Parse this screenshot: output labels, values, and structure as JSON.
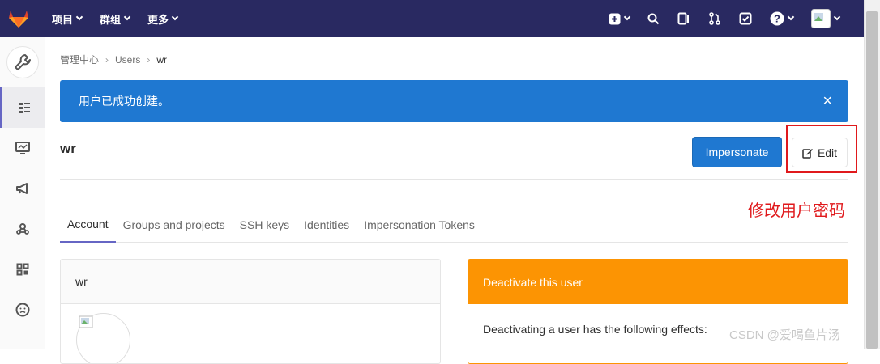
{
  "topnav": {
    "projects": "项目",
    "groups": "群组",
    "more": "更多"
  },
  "breadcrumb": {
    "admin": "管理中心",
    "users": "Users",
    "current": "wr"
  },
  "alert": {
    "message": "用户已成功创建。",
    "close": "×"
  },
  "user": {
    "username": "wr"
  },
  "buttons": {
    "impersonate": "Impersonate",
    "edit": "Edit"
  },
  "annotation": "修改用户密码",
  "tabs": [
    "Account",
    "Groups and projects",
    "SSH keys",
    "Identities",
    "Impersonation Tokens"
  ],
  "profile_card": {
    "title": "wr"
  },
  "deactivate_card": {
    "title": "Deactivate this user",
    "body": "Deactivating a user has the following effects:"
  },
  "watermark": "CSDN @爱喝鱼片汤",
  "colors": {
    "navbar": "#292961",
    "alert": "#1f78d1",
    "warning": "#fc9403",
    "highlight": "#e0191c"
  }
}
